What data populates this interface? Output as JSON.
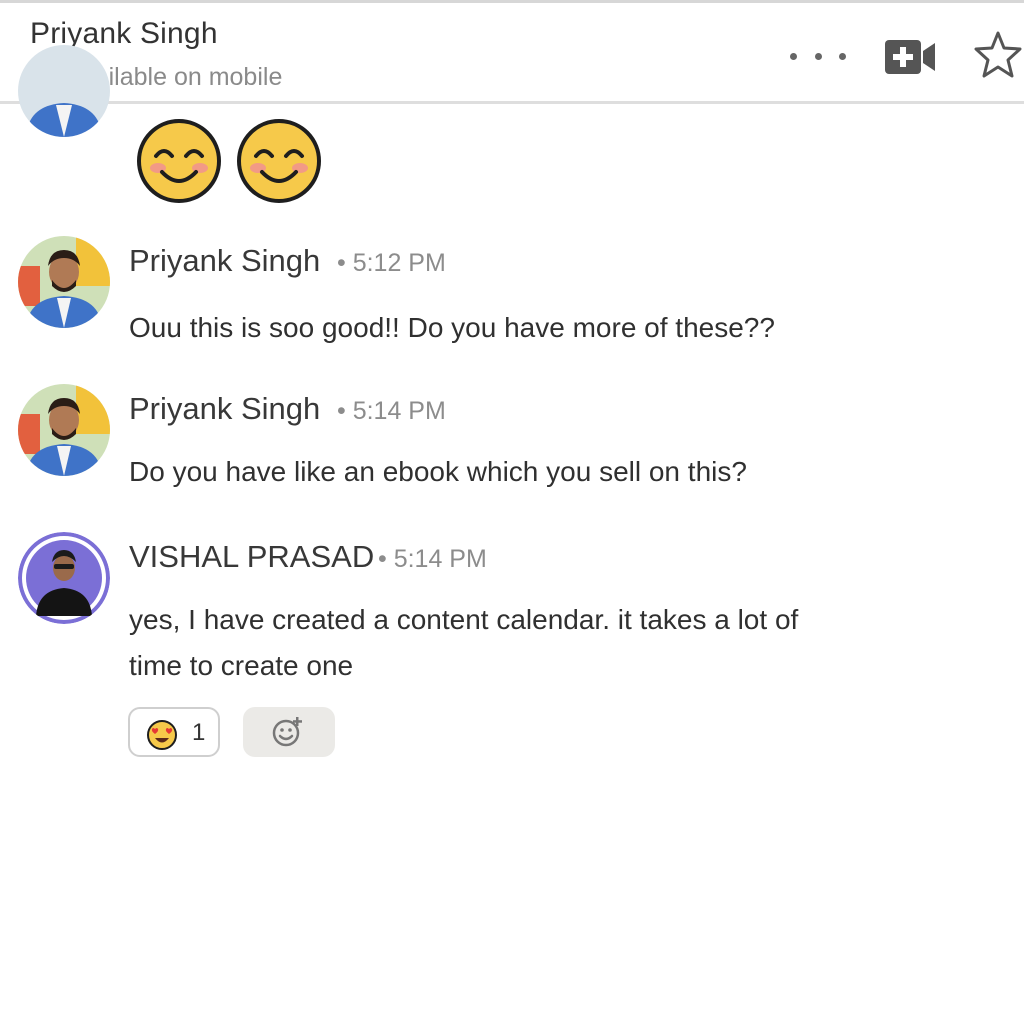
{
  "header": {
    "contact_name": "Priyank Singh",
    "presence_status": "Available on mobile",
    "presence_color": "#2f9e5b",
    "actions": {
      "more_icon": "more-horizontal-icon",
      "video_icon": "video-call-icon",
      "favorite_icon": "star-outline-icon"
    }
  },
  "messages": [
    {
      "type": "emoji",
      "emojis": [
        "smiling-face-icon",
        "smiling-face-icon"
      ]
    },
    {
      "sender": "Priyank Singh",
      "time": "• 5:12 PM",
      "text": "Ouu this is soo good!! Do you have more of these??"
    },
    {
      "sender": "Priyank Singh",
      "time": "• 5:14 PM",
      "text": "Do you have like an ebook which you sell on this?"
    },
    {
      "sender": "VISHAL PRASAD",
      "time": "• 5:14 PM",
      "text_line1": "yes, I have created a content calendar. it takes a lot of",
      "text_line2": "time to create one",
      "reactions": [
        {
          "emoji": "heart-eyes-icon",
          "count": "1"
        }
      ],
      "add_reaction_icon": "add-reaction-icon"
    }
  ],
  "colors": {
    "accent_avatar_ring": "#7b6fd6",
    "emoji_yellow": "#f6c94a",
    "muted_text": "#8c8c8c"
  }
}
